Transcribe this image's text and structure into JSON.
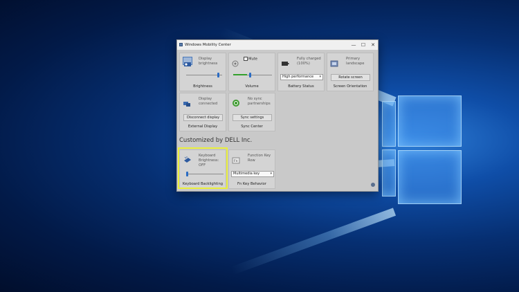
{
  "window": {
    "title": "Windows Mobility Center",
    "minimize": "—",
    "maximize": "☐",
    "close": "✕"
  },
  "tiles": {
    "brightness": {
      "label": "Display brightness",
      "caption": "Brightness",
      "level": 0.82
    },
    "volume": {
      "mute_label": "Mute",
      "caption": "Volume",
      "level": 0.4
    },
    "battery": {
      "status": "Fully charged (100%)",
      "plan": "High performance",
      "caption": "Battery Status"
    },
    "orientation": {
      "label": "Primary landscape",
      "button": "Rotate screen",
      "caption": "Screen Orientation"
    },
    "external_display": {
      "label": "Display connected",
      "button": "Disconnect display",
      "caption": "External Display"
    },
    "sync": {
      "label": "No sync partnerships",
      "button": "Sync settings",
      "caption": "Sync Center"
    }
  },
  "customized": {
    "heading": "Customized by DELL Inc.",
    "keyboard": {
      "label": "Keyboard Brightness: OFF",
      "caption": "Keyboard Backlighting",
      "level": 0.0
    },
    "fnkey": {
      "label": "Function Key Row",
      "value": "Multimedia key",
      "caption": "Fn Key Behavior"
    }
  },
  "colors": {
    "highlight": "#e9ef3a",
    "accent": "#2b6cc4"
  }
}
